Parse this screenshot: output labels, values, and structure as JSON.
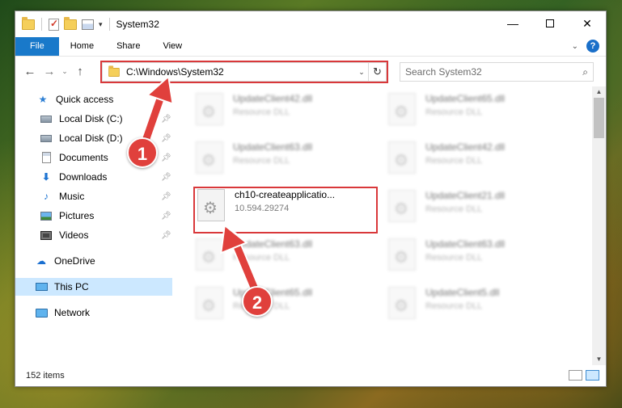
{
  "window": {
    "title": "System32",
    "minimize_glyph": "—",
    "close_glyph": "✕"
  },
  "ribbon": {
    "tabs": [
      "File",
      "Home",
      "Share",
      "View"
    ],
    "help_label": "?"
  },
  "address_bar": {
    "path": "C:\\Windows\\System32"
  },
  "search": {
    "placeholder": "Search System32"
  },
  "sidebar": {
    "items": [
      {
        "label": "Quick access",
        "icon": "star-icon",
        "pinned": false
      },
      {
        "label": "Local Disk (C:)",
        "icon": "disk-icon",
        "pinned": true
      },
      {
        "label": "Local Disk (D:)",
        "icon": "disk-icon",
        "pinned": true
      },
      {
        "label": "Documents",
        "icon": "documents-icon",
        "pinned": true
      },
      {
        "label": "Downloads",
        "icon": "downloads-icon",
        "pinned": true
      },
      {
        "label": "Music",
        "icon": "music-icon",
        "pinned": true
      },
      {
        "label": "Pictures",
        "icon": "pictures-icon",
        "pinned": true
      },
      {
        "label": "Videos",
        "icon": "videos-icon",
        "pinned": true
      },
      {
        "label": "OneDrive",
        "icon": "onedrive-icon",
        "pinned": false
      },
      {
        "label": "This PC",
        "icon": "this-pc-icon",
        "pinned": false,
        "selected": true
      },
      {
        "label": "Network",
        "icon": "network-icon",
        "pinned": false
      }
    ]
  },
  "files": {
    "left_column": [
      {
        "name": "UpdateClient42.dll",
        "type": "Resource DLL",
        "blurred": true
      },
      {
        "name": "UpdateClient63.dll",
        "type": "Resource DLL",
        "blurred": true
      },
      {
        "name": "ch10-createapplicatio...",
        "type": "10.594.29274",
        "blurred": false,
        "highlighted": true
      },
      {
        "name": "UpdateClient63.dll",
        "type": "Resource DLL",
        "blurred": true
      },
      {
        "name": "UpdateClient65.dll",
        "type": "Resource DLL",
        "blurred": true
      }
    ],
    "right_column": [
      {
        "name": "UpdateClient65.dll",
        "type": "Resource DLL",
        "blurred": true
      },
      {
        "name": "UpdateClient42.dll",
        "type": "Resource DLL",
        "blurred": true
      },
      {
        "name": "UpdateClient21.dll",
        "type": "Resource DLL",
        "blurred": true
      },
      {
        "name": "UpdateClient63.dll",
        "type": "Resource DLL",
        "blurred": true
      },
      {
        "name": "UpdateClient5.dll",
        "type": "Resource DLL",
        "blurred": true
      }
    ]
  },
  "status": {
    "item_count": "152 items"
  },
  "annotations": {
    "step1": "1",
    "step2": "2",
    "highlight_color": "#d9383a"
  },
  "colors": {
    "file_tab": "#1979ca",
    "selected_nav": "#cce8ff",
    "accent": "#1a6fc9"
  }
}
